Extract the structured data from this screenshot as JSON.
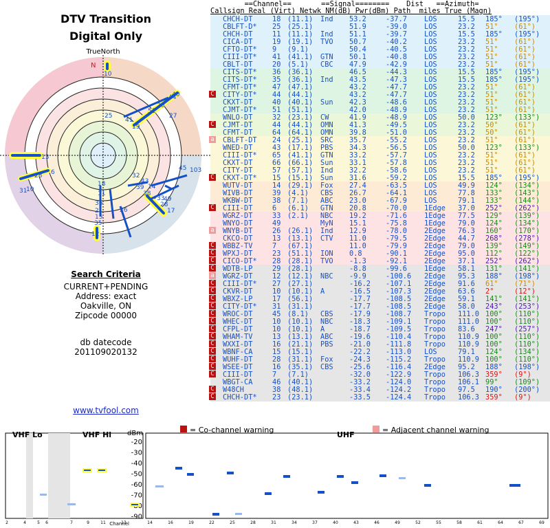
{
  "left": {
    "title1": "DTV Transition",
    "title2": "Digital Only",
    "compass_label": "TrueNorth",
    "north": "N",
    "criteria_heading": "Search Criteria",
    "criteria_lines": [
      "CURRENT+PENDING",
      "Address: exact",
      "Oakville, ON",
      "Zipcode 00000"
    ],
    "db_label": "db datecode",
    "db_value": "201109020132",
    "link": "www.tvfool.com"
  },
  "polar_labels": [
    "10",
    "40",
    "44",
    "20",
    "51",
    "27",
    "19",
    "41",
    "25",
    "13",
    "6",
    "28",
    "10",
    "31",
    "45",
    "103",
    "32",
    "43",
    "14",
    "39",
    "36",
    "38",
    "33",
    "49",
    "28",
    "18",
    "11",
    "36",
    "21",
    "15",
    "35",
    "26",
    "12"
  ],
  "table": {
    "header1": "        ==Channel==       ==Signal========    Dist   ==Azimuth=",
    "header2": "Callsign Real (Virt) Netwk NM(dB) Pwr(dBm) Path  miles True (Magn)",
    "rows": [
      {
        "mark": "",
        "call": "CHCH-DT",
        "real": "18",
        "virt": "(11.1)",
        "net": "Ind",
        "nm": "53.2",
        "pwr": "-37.7",
        "path": "LOS",
        "dist": "15.5",
        "az": "185°",
        "mag": "(195°)",
        "bg": "#dff1fb",
        "azc": "c-los"
      },
      {
        "mark": "",
        "call": "CBLFT-D*",
        "real": "25",
        "virt": "(25.1)",
        "net": "",
        "nm": "51.9",
        "pwr": "-39.0",
        "path": "LOS",
        "dist": "23.2",
        "az": "51°",
        "mag": "(61°)",
        "bg": "#dff1fb",
        "azc": "c-orange"
      },
      {
        "mark": "",
        "call": "CHCH-DT",
        "real": "11",
        "virt": "(11.1)",
        "net": "Ind",
        "nm": "51.1",
        "pwr": "-39.7",
        "path": "LOS",
        "dist": "15.5",
        "az": "185°",
        "mag": "(195°)",
        "bg": "#dff1fb",
        "azc": "c-los"
      },
      {
        "mark": "",
        "call": "CICA-DT",
        "real": "19",
        "virt": "(19.1)",
        "net": "TVO",
        "nm": "50.7",
        "pwr": "-40.2",
        "path": "LOS",
        "dist": "23.2",
        "az": "51°",
        "mag": "(61°)",
        "bg": "#dff1fb",
        "azc": "c-orange"
      },
      {
        "mark": "",
        "call": "CFTO-DT*",
        "real": "9",
        "virt": "(9.1)",
        "net": "",
        "nm": "50.4",
        "pwr": "-40.5",
        "path": "LOS",
        "dist": "23.2",
        "az": "51°",
        "mag": "(61°)",
        "bg": "#dff1fb",
        "azc": "c-orange"
      },
      {
        "mark": "",
        "call": "CIII-DT*",
        "real": "41",
        "virt": "(41.1)",
        "net": "GTN",
        "nm": "50.1",
        "pwr": "-40.8",
        "path": "LOS",
        "dist": "23.2",
        "az": "51°",
        "mag": "(61°)",
        "bg": "#dff1fb",
        "azc": "c-orange"
      },
      {
        "mark": "",
        "call": "CBLT-DT",
        "real": "20",
        "virt": "(5.1)",
        "net": "CBC",
        "nm": "47.9",
        "pwr": "-42.9",
        "path": "LOS",
        "dist": "23.2",
        "az": "51°",
        "mag": "(61°)",
        "bg": "#dff1fb",
        "azc": "c-orange"
      },
      {
        "mark": "",
        "call": "CITS-DT*",
        "real": "36",
        "virt": "(36.1)",
        "net": "",
        "nm": "46.5",
        "pwr": "-44.3",
        "path": "LOS",
        "dist": "15.5",
        "az": "185°",
        "mag": "(195°)",
        "bg": "#dff5e4",
        "azc": "c-los"
      },
      {
        "mark": "",
        "call": "CITS-DT*",
        "real": "35",
        "virt": "(36.1)",
        "net": "Ind",
        "nm": "43.5",
        "pwr": "-47.3",
        "path": "LOS",
        "dist": "15.5",
        "az": "185°",
        "mag": "(195°)",
        "bg": "#dff5e4",
        "azc": "c-los"
      },
      {
        "mark": "",
        "call": "CFMT-DT*",
        "real": "47",
        "virt": "(47.1)",
        "net": "",
        "nm": "43.2",
        "pwr": "-47.7",
        "path": "LOS",
        "dist": "23.2",
        "az": "51°",
        "mag": "(61°)",
        "bg": "#dff5e4",
        "azc": "c-orange"
      },
      {
        "mark": "C",
        "call": "CITY-DT*",
        "real": "44",
        "virt": "(44.1)",
        "net": "",
        "nm": "43.2",
        "pwr": "-47.7",
        "path": "LOS",
        "dist": "23.2",
        "az": "51°",
        "mag": "(61°)",
        "bg": "#dff5e4",
        "azc": "c-orange"
      },
      {
        "mark": "",
        "call": "CKXT-DT",
        "real": "40",
        "virt": "(40.1)",
        "net": "Sun",
        "nm": "42.3",
        "pwr": "-48.6",
        "path": "LOS",
        "dist": "23.2",
        "az": "51°",
        "mag": "(61°)",
        "bg": "#dff5e4",
        "azc": "c-orange"
      },
      {
        "mark": "",
        "call": "CJMT-DT*",
        "real": "51",
        "virt": "(51.1)",
        "net": "",
        "nm": "42.0",
        "pwr": "-48.9",
        "path": "LOS",
        "dist": "23.2",
        "az": "51°",
        "mag": "(61°)",
        "bg": "#dff5e4",
        "azc": "c-orange"
      },
      {
        "mark": "",
        "call": "WNLO-DT",
        "real": "32",
        "virt": "(23.1)",
        "net": "CW",
        "nm": "41.9",
        "pwr": "-48.9",
        "path": "LOS",
        "dist": "50.0",
        "az": "123°",
        "mag": "(133°)",
        "bg": "#eaf7d9",
        "azc": "c-green"
      },
      {
        "mark": "C",
        "call": "CJMT-DT",
        "real": "44",
        "virt": "(44.1)",
        "net": "OMN",
        "nm": "41.3",
        "pwr": "-49.5",
        "path": "LOS",
        "dist": "23.2",
        "az": "50°",
        "mag": "(61°)",
        "bg": "#eaf7d9",
        "azc": "c-orange"
      },
      {
        "mark": "",
        "call": "CFMT-DT",
        "real": "64",
        "virt": "(64.1)",
        "net": "OMN",
        "nm": "39.8",
        "pwr": "-51.0",
        "path": "LOS",
        "dist": "23.2",
        "az": "50°",
        "mag": "(61°)",
        "bg": "#eaf7d9",
        "azc": "c-orange"
      },
      {
        "mark": "a",
        "call": "CBLFT-DT",
        "real": "24",
        "virt": "(25.1)",
        "net": "SRC",
        "nm": "35.7",
        "pwr": "-55.2",
        "path": "LOS",
        "dist": "23.2",
        "az": "51°",
        "mag": "(61°)",
        "bg": "#fcf7d6",
        "azc": "c-orange"
      },
      {
        "mark": "",
        "call": "WNED-DT",
        "real": "43",
        "virt": "(17.1)",
        "net": "PBS",
        "nm": "34.3",
        "pwr": "-56.5",
        "path": "LOS",
        "dist": "50.0",
        "az": "123°",
        "mag": "(133°)",
        "bg": "#fcf7d6",
        "azc": "c-green"
      },
      {
        "mark": "",
        "call": "CIII-DT*",
        "real": "65",
        "virt": "(41.1)",
        "net": "GTN",
        "nm": "33.2",
        "pwr": "-57.7",
        "path": "LOS",
        "dist": "23.2",
        "az": "51°",
        "mag": "(61°)",
        "bg": "#fcf7d6",
        "azc": "c-orange"
      },
      {
        "mark": "",
        "call": "CKXT-DT",
        "real": "66",
        "virt": "(66.1)",
        "net": "Sun",
        "nm": "33.1",
        "pwr": "-57.8",
        "path": "LOS",
        "dist": "23.2",
        "az": "51°",
        "mag": "(61°)",
        "bg": "#fcf7d6",
        "azc": "c-orange"
      },
      {
        "mark": "",
        "call": "CITY-DT",
        "real": "57",
        "virt": "(57.1)",
        "net": "Ind",
        "nm": "32.2",
        "pwr": "-58.6",
        "path": "LOS",
        "dist": "23.2",
        "az": "51°",
        "mag": "(61°)",
        "bg": "#fcf7d6",
        "azc": "c-orange"
      },
      {
        "mark": "C",
        "call": "CKXT-DT*",
        "real": "15",
        "virt": "(15.1)",
        "net": "Sun",
        "nm": "31.6",
        "pwr": "-59.2",
        "path": "LOS",
        "dist": "15.5",
        "az": "185°",
        "mag": "(195°)",
        "bg": "#fcf7d6",
        "azc": "c-los"
      },
      {
        "mark": "",
        "call": "WUTV-DT",
        "real": "14",
        "virt": "(29.1)",
        "net": "Fox",
        "nm": "27.4",
        "pwr": "-63.5",
        "path": "LOS",
        "dist": "49.9",
        "az": "124°",
        "mag": "(134°)",
        "bg": "#fdebd5",
        "azc": "c-green"
      },
      {
        "mark": "",
        "call": "WIVB-DT",
        "real": "39",
        "virt": "(4.1)",
        "net": "CBS",
        "nm": "26.7",
        "pwr": "-64.1",
        "path": "LOS",
        "dist": "77.8",
        "az": "133°",
        "mag": "(143°)",
        "bg": "#fdebd5",
        "azc": "c-green"
      },
      {
        "mark": "",
        "call": "WKBW-DT",
        "real": "38",
        "virt": "(7.1)",
        "net": "ABC",
        "nm": "23.0",
        "pwr": "-67.9",
        "path": "LOS",
        "dist": "79.1",
        "az": "133°",
        "mag": "(144°)",
        "bg": "#fdebd5",
        "azc": "c-green"
      },
      {
        "mark": "C",
        "call": "CIII-DT",
        "real": "6",
        "virt": "(6.1)",
        "net": "GTN",
        "nm": "20.8",
        "pwr": "-70.0",
        "path": "1Edge",
        "dist": "37.0",
        "az": "252°",
        "mag": "(262°)",
        "bg": "#fdebd5",
        "azc": "c-purple"
      },
      {
        "mark": "",
        "call": "WGRZ-DT",
        "real": "33",
        "virt": "(2.1)",
        "net": "NBC",
        "nm": "19.2",
        "pwr": "-71.6",
        "path": "1Edge",
        "dist": "77.5",
        "az": "129°",
        "mag": "(139°)",
        "bg": "#fde3e3",
        "azc": "c-green"
      },
      {
        "mark": "",
        "call": "WNYO-DT",
        "real": "49",
        "virt": "",
        "net": "MyN",
        "nm": "15.1",
        "pwr": "-75.8",
        "path": "1Edge",
        "dist": "79.0",
        "az": "124°",
        "mag": "(134°)",
        "bg": "#fde3e3",
        "azc": "c-green"
      },
      {
        "mark": "a",
        "call": "WNYB-DT",
        "real": "26",
        "virt": "(26.1)",
        "net": "Ind",
        "nm": "12.9",
        "pwr": "-78.0",
        "path": "2Edge",
        "dist": "76.3",
        "az": "160°",
        "mag": "(170°)",
        "bg": "#fde3e3",
        "azc": "c-green"
      },
      {
        "mark": "",
        "call": "CKCO-DT",
        "real": "13",
        "virt": "(13.1)",
        "net": "CTV",
        "nm": "11.0",
        "pwr": "-79.5",
        "path": "2Edge",
        "dist": "44.7",
        "az": "268°",
        "mag": "(278°)",
        "bg": "#fde3e3",
        "azc": "c-purple"
      },
      {
        "mark": "C",
        "call": "WBBZ-TV",
        "real": "7",
        "virt": "(67.1)",
        "net": "",
        "nm": "11.0",
        "pwr": "-79.9",
        "path": "2Edge",
        "dist": "79.0",
        "az": "139°",
        "mag": "(149°)",
        "bg": "#fde3e3",
        "azc": "c-green"
      },
      {
        "mark": "C",
        "call": "WPXJ-DT",
        "real": "23",
        "virt": "(51.1)",
        "net": "ION",
        "nm": "0.8",
        "pwr": "-90.1",
        "path": "2Edge",
        "dist": "95.0",
        "az": "112°",
        "mag": "(122°)",
        "bg": "#fde3e3",
        "azc": "c-green"
      },
      {
        "mark": "C",
        "call": "CICO-DT*",
        "real": "28",
        "virt": "(28.1)",
        "net": "TVO",
        "nm": "-1.3",
        "pwr": "-92.1",
        "path": "2Edge",
        "dist": "37.1",
        "az": "252°",
        "mag": "(262°)",
        "bg": "#fde3e3",
        "azc": "c-purple"
      },
      {
        "mark": "C",
        "call": "WDTB-LP",
        "real": "29",
        "virt": "(28.1)",
        "net": "",
        "nm": "-8.8",
        "pwr": "-99.6",
        "path": "1Edge",
        "dist": "58.1",
        "az": "131°",
        "mag": "(141°)",
        "bg": "#e6e6e6",
        "azc": "c-green"
      },
      {
        "mark": "a",
        "call": "WGRZ-DT",
        "real": "12",
        "virt": "(12.1)",
        "net": "NBC",
        "nm": "-9.9",
        "pwr": "-100.6",
        "path": "2Edge",
        "dist": "95.3",
        "az": "188°",
        "mag": "(198°)",
        "bg": "#e6e6e6",
        "azc": "c-los"
      },
      {
        "mark": "C",
        "call": "CIII-DT*",
        "real": "27",
        "virt": "(27.1)",
        "net": "",
        "nm": "-16.2",
        "pwr": "-107.1",
        "path": "2Edge",
        "dist": "91.6",
        "az": "61°",
        "mag": "(71°)",
        "bg": "#e6e6e6",
        "azc": "c-orange"
      },
      {
        "mark": "C",
        "call": "CKVR-DT",
        "real": "10",
        "virt": "(10.1)",
        "net": "A",
        "nm": "-16.5",
        "pwr": "-107.3",
        "path": "2Edge",
        "dist": "63.6",
        "az": "2°",
        "mag": "(12°)",
        "bg": "#e6e6e6",
        "azc": "c-red"
      },
      {
        "mark": "C",
        "call": "WBXZ-LP",
        "real": "17",
        "virt": "(56.1)",
        "net": "",
        "nm": "-17.7",
        "pwr": "-108.5",
        "path": "2Edge",
        "dist": "59.1",
        "az": "141°",
        "mag": "(141°)",
        "bg": "#e6e6e6",
        "azc": "c-green"
      },
      {
        "mark": "C",
        "call": "CITY-DT*",
        "real": "31",
        "virt": "(31.1)",
        "net": "",
        "nm": "-17.7",
        "pwr": "-108.5",
        "path": "2Edge",
        "dist": "58.0",
        "az": "243°",
        "mag": "(253°)",
        "bg": "#e6e6e6",
        "azc": "c-purple"
      },
      {
        "mark": "C",
        "call": "WROC-DT",
        "real": "45",
        "virt": "(8.1)",
        "net": "CBS",
        "nm": "-17.9",
        "pwr": "-108.7",
        "path": "Tropo",
        "dist": "111.0",
        "az": "100°",
        "mag": "(110°)",
        "bg": "#e6e6e6",
        "azc": "c-green"
      },
      {
        "mark": "C",
        "call": "WHEC-DT",
        "real": "10",
        "virt": "(10.1)",
        "net": "NBC",
        "nm": "-18.3",
        "pwr": "-109.1",
        "path": "Tropo",
        "dist": "111.0",
        "az": "100°",
        "mag": "(110°)",
        "bg": "#e6e6e6",
        "azc": "c-green"
      },
      {
        "mark": "C",
        "call": "CFPL-DT",
        "real": "10",
        "virt": "(10.1)",
        "net": "A",
        "nm": "-18.7",
        "pwr": "-109.5",
        "path": "Tropo",
        "dist": "83.6",
        "az": "247°",
        "mag": "(257°)",
        "bg": "#e6e6e6",
        "azc": "c-purple"
      },
      {
        "mark": "C",
        "call": "WHAM-TV",
        "real": "13",
        "virt": "(13.1)",
        "net": "ABC",
        "nm": "-19.6",
        "pwr": "-110.4",
        "path": "Tropo",
        "dist": "110.9",
        "az": "100°",
        "mag": "(110°)",
        "bg": "#e6e6e6",
        "azc": "c-green"
      },
      {
        "mark": "C",
        "call": "WXXI-DT",
        "real": "16",
        "virt": "(21.1)",
        "net": "PBS",
        "nm": "-21.0",
        "pwr": "-111.8",
        "path": "Tropo",
        "dist": "110.9",
        "az": "100°",
        "mag": "(110°)",
        "bg": "#e6e6e6",
        "azc": "c-green"
      },
      {
        "mark": "C",
        "call": "WBNF-CA",
        "real": "15",
        "virt": "(15.1)",
        "net": "",
        "nm": "-22.2",
        "pwr": "-113.0",
        "path": "LOS",
        "dist": "79.1",
        "az": "124°",
        "mag": "(134°)",
        "bg": "#e6e6e6",
        "azc": "c-green"
      },
      {
        "mark": "C",
        "call": "WUHF-DT",
        "real": "28",
        "virt": "(31.1)",
        "net": "Fox",
        "nm": "-24.3",
        "pwr": "-115.2",
        "path": "Tropo",
        "dist": "110.9",
        "az": "100°",
        "mag": "(110°)",
        "bg": "#e6e6e6",
        "azc": "c-green"
      },
      {
        "mark": "C",
        "call": "WSEE-DT",
        "real": "16",
        "virt": "(35.1)",
        "net": "CBS",
        "nm": "-25.6",
        "pwr": "-116.4",
        "path": "2Edge",
        "dist": "95.2",
        "az": "188°",
        "mag": "(198°)",
        "bg": "#e6e6e6",
        "azc": "c-los"
      },
      {
        "mark": "C",
        "call": "CIII-DT",
        "real": "7",
        "virt": "(7.1)",
        "net": "",
        "nm": "-32.0",
        "pwr": "-122.9",
        "path": "Tropo",
        "dist": "106.3",
        "az": "359°",
        "mag": "(9°)",
        "bg": "#e6e6e6",
        "azc": "c-red"
      },
      {
        "mark": "",
        "call": "WBGT-CA",
        "real": "46",
        "virt": "(40.1)",
        "net": "",
        "nm": "-33.2",
        "pwr": "-124.0",
        "path": "Tropo",
        "dist": "106.1",
        "az": "99°",
        "mag": "(109°)",
        "bg": "#e6e6e6",
        "azc": "c-green"
      },
      {
        "mark": "C",
        "call": "W48CH",
        "real": "38",
        "virt": "(48.1)",
        "net": "",
        "nm": "-33.4",
        "pwr": "-124.2",
        "path": "Tropo",
        "dist": "97.5",
        "az": "190°",
        "mag": "(200°)",
        "bg": "#e6e6e6",
        "azc": "c-los"
      },
      {
        "mark": "C",
        "call": "CHCH-DT*",
        "real": "23",
        "virt": "(23.1)",
        "net": "",
        "nm": "-33.5",
        "pwr": "-124.4",
        "path": "Tropo",
        "dist": "106.3",
        "az": "359°",
        "mag": "(9°)",
        "bg": "#e6e6e6",
        "azc": "c-red"
      }
    ]
  },
  "spectrum": {
    "vhf_lo": "VHF Lo",
    "vhf_hi": "VHF Hi",
    "uhf": "UHF",
    "dbm": "dBm",
    "channel_label": "Channel",
    "legend_co": "= Co-channel warning",
    "legend_adj": "= Adjacent channel warning",
    "y_ticks": [
      "-20",
      "-30",
      "-40",
      "-50",
      "-60",
      "-70",
      "-80",
      "-90"
    ],
    "lo_ticks": [
      "2",
      "4",
      "5",
      "6"
    ],
    "hi_ticks": [
      "7",
      "9",
      "11",
      "13"
    ],
    "uhf_ticks": [
      "14",
      "16",
      "19",
      "22",
      "25",
      "28",
      "31",
      "34",
      "37",
      "40",
      "43",
      "46",
      "49",
      "52",
      "55",
      "58",
      "61",
      "64",
      "67",
      "69"
    ]
  }
}
